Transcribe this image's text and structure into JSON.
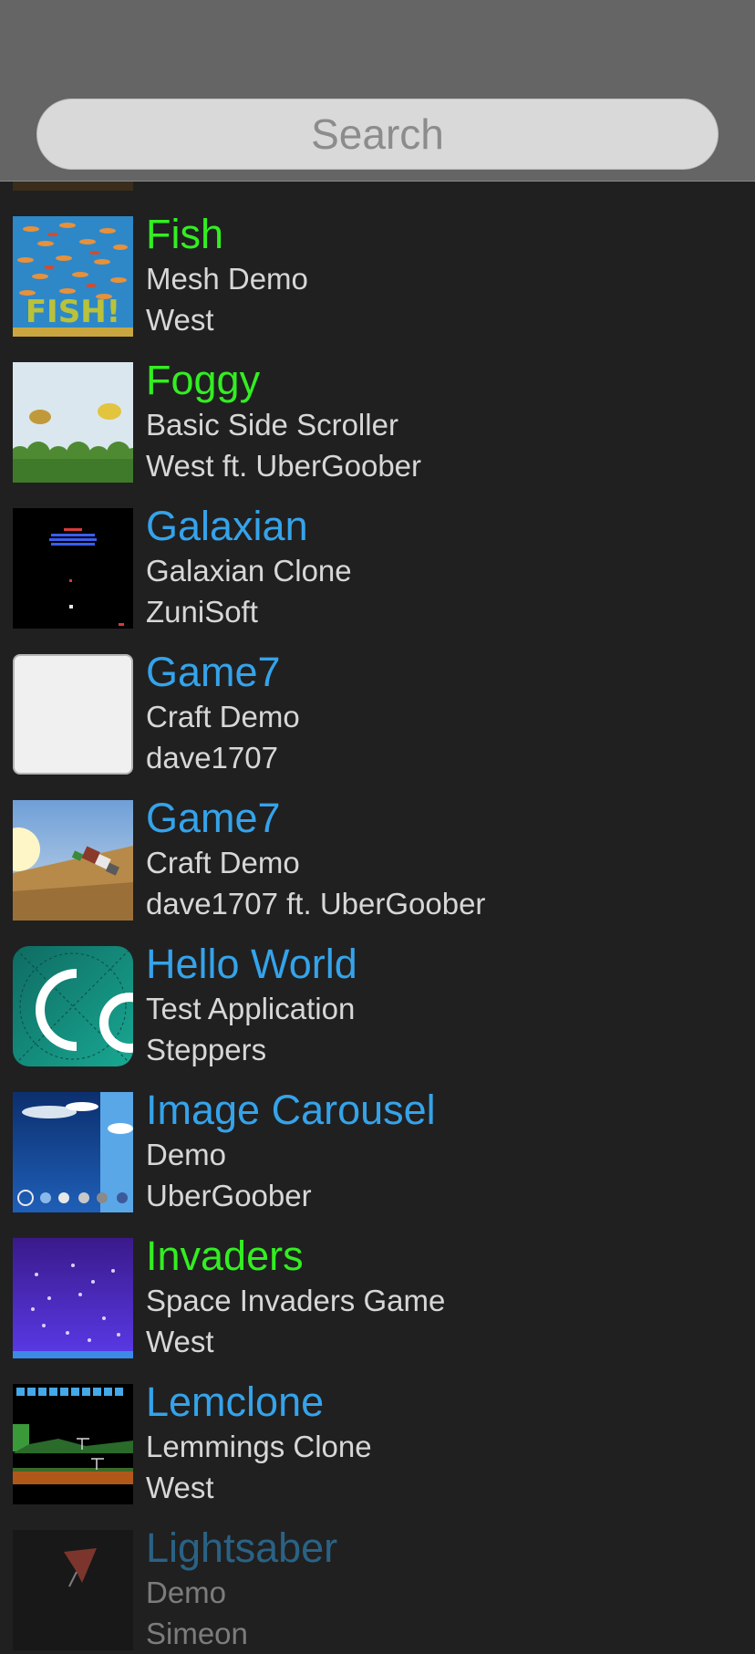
{
  "search": {
    "placeholder": "Search"
  },
  "colors": {
    "green_title": "#33ee22",
    "blue_title": "#35a3ea",
    "subtitle": "#d7d7d7",
    "background": "#202020"
  },
  "projects": [
    {
      "title": "Fish",
      "subtitle": "Mesh Demo",
      "author": "West",
      "title_color": "#33ee22",
      "thumbnail": "fish-thumbnail"
    },
    {
      "title": "Foggy",
      "subtitle": "Basic Side Scroller",
      "author": "West ft. UberGoober",
      "title_color": "#33ee22",
      "thumbnail": "foggy-thumbnail"
    },
    {
      "title": "Galaxian",
      "subtitle": "Galaxian Clone",
      "author": "ZuniSoft",
      "title_color": "#35a3ea",
      "thumbnail": "galaxian-thumbnail"
    },
    {
      "title": "Game7",
      "subtitle": "Craft Demo",
      "author": "dave1707",
      "title_color": "#35a3ea",
      "thumbnail": "blank-thumbnail"
    },
    {
      "title": "Game7",
      "subtitle": "Craft Demo",
      "author": "dave1707 ft. UberGoober",
      "title_color": "#35a3ea",
      "thumbnail": "craft-thumbnail"
    },
    {
      "title": "Hello World",
      "subtitle": "Test Application",
      "author": "Steppers",
      "title_color": "#35a3ea",
      "thumbnail": "codea-logo-thumbnail"
    },
    {
      "title": "Image Carousel",
      "subtitle": "Demo",
      "author": "UberGoober",
      "title_color": "#35a3ea",
      "thumbnail": "carousel-thumbnail"
    },
    {
      "title": "Invaders",
      "subtitle": "Space Invaders Game",
      "author": "West",
      "title_color": "#33ee22",
      "thumbnail": "invaders-thumbnail"
    },
    {
      "title": "Lemclone",
      "subtitle": "Lemmings Clone",
      "author": "West",
      "title_color": "#35a3ea",
      "thumbnail": "lemmings-thumbnail"
    },
    {
      "title": "Lightsaber",
      "subtitle": "Demo",
      "author": "Simeon",
      "title_color": "#35a3ea",
      "thumbnail": "lightsaber-thumbnail"
    }
  ]
}
